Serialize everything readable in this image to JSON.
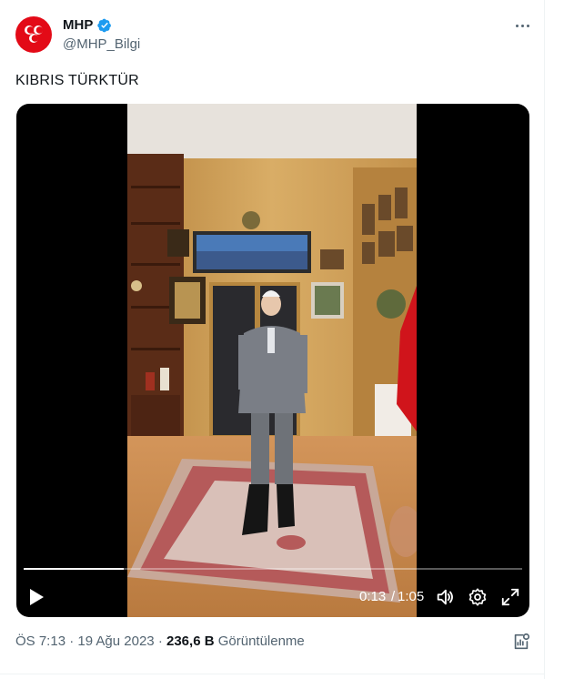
{
  "author": {
    "display_name": "MHP",
    "handle": "@MHP_Bilgi",
    "avatar_icon": "mhp-crescents-logo",
    "verified_icon": "verified-badge-icon",
    "brand_color": "#e30a17"
  },
  "tweet": {
    "text": "KIBRIS TÜRKTÜR"
  },
  "video": {
    "current_time": "0:13",
    "separator": "/",
    "duration": "1:05",
    "progress": 0.2,
    "controls": [
      "play-icon",
      "volume-icon",
      "settings-icon",
      "fullscreen-icon"
    ]
  },
  "footer": {
    "time": "ÖS 7:13",
    "dot1": "·",
    "date": "19 Ağu 2023",
    "dot2": "·",
    "views_count": "236,6 B",
    "views_label": "Görüntülenme"
  },
  "colors": {
    "secondary_text": "#536471",
    "primary_text": "#0f1419",
    "verified_blue": "#1d9bf0"
  }
}
